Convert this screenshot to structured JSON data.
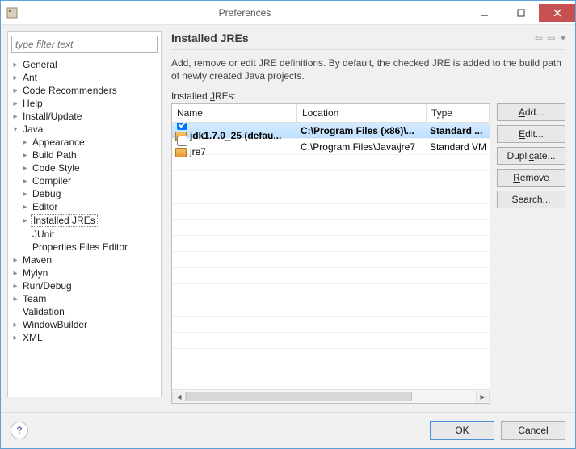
{
  "window": {
    "title": "Preferences"
  },
  "filter": {
    "placeholder": "type filter text"
  },
  "tree": [
    {
      "label": "General",
      "indent": 0,
      "expand": "collapsed"
    },
    {
      "label": "Ant",
      "indent": 0,
      "expand": "collapsed"
    },
    {
      "label": "Code Recommenders",
      "indent": 0,
      "expand": "collapsed"
    },
    {
      "label": "Help",
      "indent": 0,
      "expand": "collapsed"
    },
    {
      "label": "Install/Update",
      "indent": 0,
      "expand": "collapsed"
    },
    {
      "label": "Java",
      "indent": 0,
      "expand": "expanded"
    },
    {
      "label": "Appearance",
      "indent": 1,
      "expand": "collapsed"
    },
    {
      "label": "Build Path",
      "indent": 1,
      "expand": "collapsed"
    },
    {
      "label": "Code Style",
      "indent": 1,
      "expand": "collapsed"
    },
    {
      "label": "Compiler",
      "indent": 1,
      "expand": "collapsed"
    },
    {
      "label": "Debug",
      "indent": 1,
      "expand": "collapsed"
    },
    {
      "label": "Editor",
      "indent": 1,
      "expand": "collapsed"
    },
    {
      "label": "Installed JREs",
      "indent": 1,
      "expand": "collapsed",
      "selected": true
    },
    {
      "label": "JUnit",
      "indent": 1,
      "expand": "none"
    },
    {
      "label": "Properties Files Editor",
      "indent": 1,
      "expand": "none"
    },
    {
      "label": "Maven",
      "indent": 0,
      "expand": "collapsed"
    },
    {
      "label": "Mylyn",
      "indent": 0,
      "expand": "collapsed"
    },
    {
      "label": "Run/Debug",
      "indent": 0,
      "expand": "collapsed"
    },
    {
      "label": "Team",
      "indent": 0,
      "expand": "collapsed"
    },
    {
      "label": "Validation",
      "indent": 0,
      "expand": "none"
    },
    {
      "label": "WindowBuilder",
      "indent": 0,
      "expand": "collapsed"
    },
    {
      "label": "XML",
      "indent": 0,
      "expand": "collapsed"
    }
  ],
  "page_title": "Installed JREs",
  "description": "Add, remove or edit JRE definitions. By default, the checked JRE is added to the build path of newly created Java projects.",
  "table_label_pre": "Installed ",
  "table_label_u": "J",
  "table_label_post": "REs:",
  "columns": {
    "name": "Name",
    "location": "Location",
    "type": "Type"
  },
  "rows": [
    {
      "checked": true,
      "name": "jdk1.7.0_25 (defau...",
      "location": "C:\\Program Files (x86)\\...",
      "type": "Standard ...",
      "selected": true
    },
    {
      "checked": false,
      "name": "jre7",
      "location": "C:\\Program Files\\Java\\jre7",
      "type": "Standard VM",
      "selected": false
    }
  ],
  "buttons": {
    "add_pre": "",
    "add_u": "A",
    "add_post": "dd...",
    "edit_pre": "",
    "edit_u": "E",
    "edit_post": "dit...",
    "dup_pre": "Dupli",
    "dup_u": "c",
    "dup_post": "ate...",
    "rem_pre": "",
    "rem_u": "R",
    "rem_post": "emove",
    "search_pre": "",
    "search_u": "S",
    "search_post": "earch..."
  },
  "footer": {
    "ok": "OK",
    "cancel": "Cancel"
  }
}
